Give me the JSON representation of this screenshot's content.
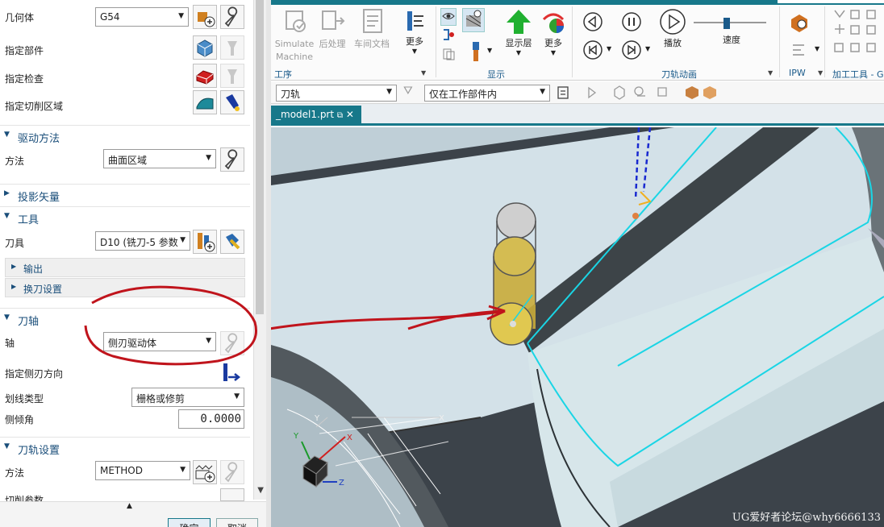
{
  "panel": {
    "geometry": {
      "label": "几何体",
      "value": "G54"
    },
    "specify_part": {
      "label": "指定部件"
    },
    "specify_check": {
      "label": "指定检查"
    },
    "specify_cut_area": {
      "label": "指定切削区域"
    },
    "drive_section": {
      "title": "驱动方法"
    },
    "method_row": {
      "label": "方法",
      "value": "曲面区域"
    },
    "projection_section": {
      "title": "投影矢量"
    },
    "tool_section": {
      "title": "工具"
    },
    "tool_row": {
      "label": "刀具",
      "value": "D10 (铣刀-5 参数"
    },
    "output": {
      "title": "输出"
    },
    "tool_change": {
      "title": "换刀设置"
    },
    "axis_section": {
      "title": "刀轴"
    },
    "axis_row": {
      "label": "轴",
      "value": "侧刃驱动体"
    },
    "side_dir": {
      "label": "指定侧刃方向"
    },
    "line_type": {
      "label": "划线类型",
      "value": "栅格或修剪"
    },
    "tilt": {
      "label": "侧倾角",
      "value": "0.0000"
    },
    "path_section": {
      "title": "刀轨设置"
    },
    "path_method": {
      "label": "方法",
      "value": "METHOD"
    },
    "cut_params": {
      "label": "切削参数"
    },
    "ok_label": "确定",
    "cancel_label": "取消"
  },
  "ribbon": {
    "simulate": "Simulate Machine",
    "postprocess": "后处理",
    "shop_doc": "车间文档",
    "more1": "更多",
    "display": "显示层",
    "more2": "更多",
    "play": "播放",
    "speed": "速度",
    "speed_fraction": 0.45,
    "groups": {
      "process": "工序",
      "display": "显示",
      "animation": "刀轨动画",
      "ipw": "IPW",
      "mfg_tools": "加工工具 - G"
    }
  },
  "toolbar2": {
    "filter": "刀轨",
    "scope": "仅在工作部件内"
  },
  "tab": {
    "label": "_model1.prt"
  },
  "viewport": {
    "watermark": "UG爱好者论坛@why6666133"
  },
  "colors": {
    "accent": "#17788a",
    "annotation": "#c0141c",
    "tool": "#d2b43c"
  }
}
